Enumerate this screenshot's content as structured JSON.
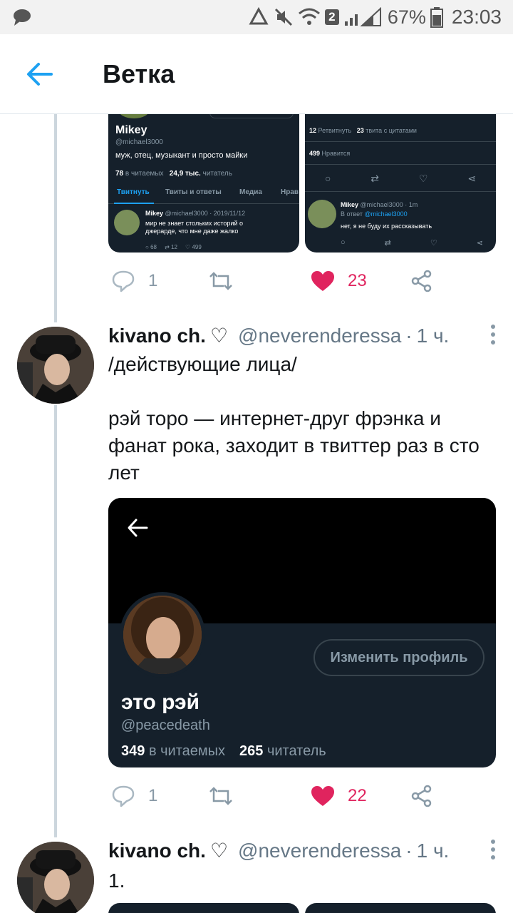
{
  "status_bar": {
    "sim_badge": "2",
    "battery": "67%",
    "time": "23:03"
  },
  "appbar": {
    "title": "Ветка"
  },
  "embedded_left": {
    "name": "Mikey",
    "handle": "@michael3000",
    "bio": "муж, отец, музыкант и просто майки",
    "following_count": "78",
    "following_label": "в читаемых",
    "followers_count": "24,9 тыс.",
    "followers_label": "читатель",
    "tabs": [
      "Твитнуть",
      "Твиты и ответы",
      "Медиа",
      "Нрав"
    ],
    "tweet_author": "Mikey",
    "tweet_meta": "@michael3000 · 2019/11/12",
    "tweet_text": "мир не знает стольких историй о джерарде, что мне даже жалко",
    "tweet_replies": "68",
    "tweet_retweets": "12",
    "tweet_likes": "499"
  },
  "embedded_right": {
    "retweets_count": "12",
    "retweets_label": "Ретвитнуть",
    "quotes_count": "23",
    "quotes_label": "твита с цитатами",
    "likes_count": "499",
    "likes_label": "Нравится",
    "reply_author": "Mikey",
    "reply_meta": "@michael3000 · 1m",
    "reply_to_label": "В ответ",
    "reply_to_handle": "@michael3000",
    "reply_text": "нет, я не буду их рассказывать"
  },
  "tweet1_actions": {
    "replies": "1",
    "likes": "23"
  },
  "tweet2": {
    "username": "kivano ch.",
    "heart_glyph": "♡",
    "handle": "@neverenderessa",
    "dot": "·",
    "time": "1 ч.",
    "text": "/действующие лица/\n\nрэй торо — интернет-друг фрэнка и фанат рока, заходит в твиттер раз в сто лет",
    "card": {
      "edit_button": "Изменить профиль",
      "name": "это рэй",
      "handle": "@peacedeath",
      "following_count": "349",
      "following_label": "в читаемых",
      "followers_count": "265",
      "followers_label": "читатель"
    },
    "replies": "1",
    "likes": "22"
  },
  "tweet3": {
    "username": "kivano ch.",
    "heart_glyph": "♡",
    "handle": "@neverenderessa",
    "dot": "·",
    "time": "1 ч.",
    "text": "1."
  },
  "colors": {
    "accent": "#1da1f2",
    "like": "#e0245e",
    "dark_card": "#15202b",
    "muted": "#8899a6"
  }
}
